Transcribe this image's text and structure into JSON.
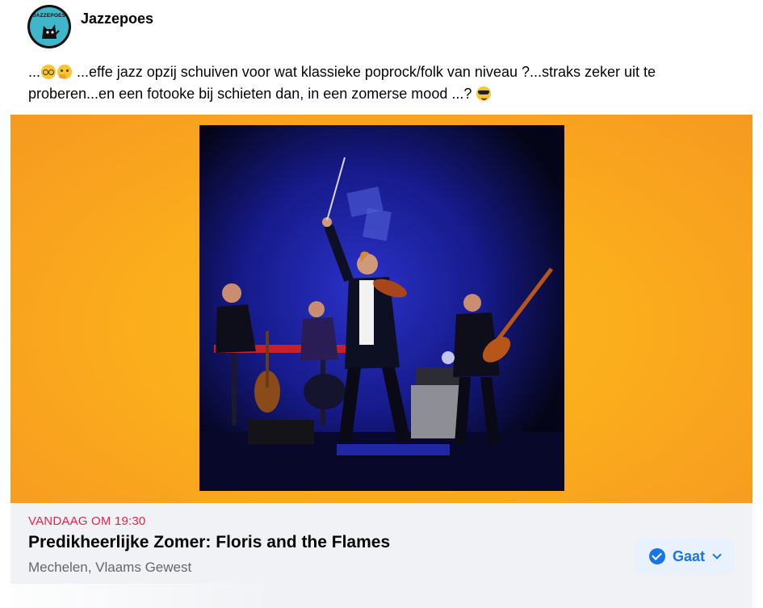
{
  "post": {
    "page_name": "Jazzepoes",
    "avatar_text": "JAZZEPOES",
    "text_prefix": "...",
    "text_body": " ...effe jazz opzij schuiven voor wat klassieke poprock/folk van niveau ?...straks zeker uit te proberen...en een fotooke bij schieten dan, in een zomerse mood ...? ",
    "emojis": [
      "nerd-face-icon",
      "thinking-face-icon",
      "sunglasses-face-icon"
    ]
  },
  "event": {
    "time": "VANDAAG OM 19:30",
    "title": "Predikheerlijke Zomer: Floris and the Flames",
    "location": "Mechelen, Vlaams Gewest",
    "rsvp_label": "Gaat"
  },
  "colors": {
    "banner": "#fbae1c",
    "event_time": "#e4254a",
    "accent": "#1b74e4",
    "rsvp_bg": "#e8f1fc"
  }
}
